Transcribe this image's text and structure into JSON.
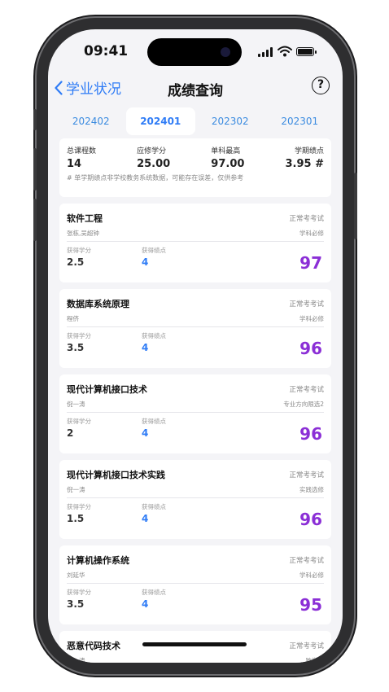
{
  "status": {
    "time": "09:41"
  },
  "nav": {
    "back_label": "学业状况",
    "title": "成绩查询",
    "help": "?"
  },
  "tabs": [
    {
      "label": "202402",
      "active": false
    },
    {
      "label": "202401",
      "active": true
    },
    {
      "label": "202302",
      "active": false
    },
    {
      "label": "202301",
      "active": false
    }
  ],
  "summary": {
    "items": [
      {
        "label": "总课程数",
        "value": "14"
      },
      {
        "label": "应修学分",
        "value": "25.00"
      },
      {
        "label": "单科最高",
        "value": "97.00"
      },
      {
        "label": "学期绩点",
        "value": "3.95 #"
      }
    ],
    "note": "# 单学期绩点非学校教务系统数据，可能存在误差，仅供参考"
  },
  "labels": {
    "credit": "获得学分",
    "gpa": "获得绩点"
  },
  "courses": [
    {
      "name": "软件工程",
      "teacher": "张栋,吴超钟",
      "exam": "正常考考试",
      "category": "学科必修",
      "credit": "2.5",
      "gpa": "4",
      "score": "97"
    },
    {
      "name": "数据库系统原理",
      "teacher": "程侪",
      "exam": "正常考考试",
      "category": "学科必修",
      "credit": "3.5",
      "gpa": "4",
      "score": "96"
    },
    {
      "name": "现代计算机接口技术",
      "teacher": "倪一涛",
      "exam": "正常考考试",
      "category": "专业方向限选2",
      "credit": "2",
      "gpa": "4",
      "score": "96"
    },
    {
      "name": "现代计算机接口技术实践",
      "teacher": "倪一涛",
      "exam": "正常考考试",
      "category": "实践选修",
      "credit": "1.5",
      "gpa": "4",
      "score": "96"
    },
    {
      "name": "计算机操作系统",
      "teacher": "刘延华",
      "exam": "正常考考试",
      "category": "学科必修",
      "credit": "3.5",
      "gpa": "4",
      "score": "95"
    },
    {
      "name": "恶意代码技术",
      "teacher": "倪一涛",
      "exam": "正常考考试",
      "category": "跨学科",
      "credit": "",
      "gpa": "",
      "score": ""
    }
  ]
}
